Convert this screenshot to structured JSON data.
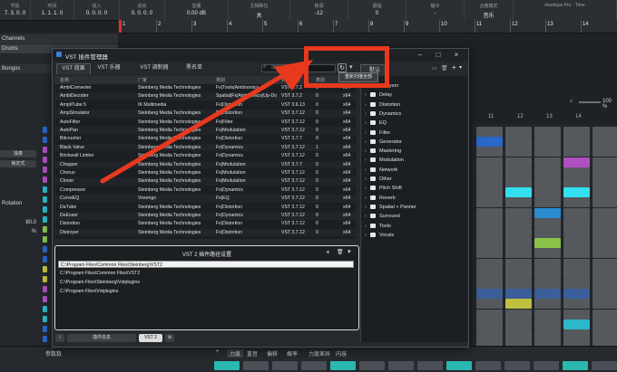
{
  "transport": [
    {
      "label": "节拍",
      "value": "7. 3. 0. 0"
    },
    {
      "label": "时间",
      "value": "1. 1. 1. 0"
    },
    {
      "label": "说入",
      "value": "0. 0. 0. 0"
    },
    {
      "label": "说出",
      "value": "0. 0. 0. 0"
    },
    {
      "label": "音量",
      "value": "0.00  dB"
    },
    {
      "label": "互相移位",
      "value": "关"
    },
    {
      "label": "移调",
      "value": "-12"
    },
    {
      "label": "振幅",
      "value": "0"
    },
    {
      "label": "轴令",
      "value": "-"
    },
    {
      "label": "合奏模式",
      "value": "音乐"
    },
    {
      "label": "elastique Pro - Time",
      "value": ""
    }
  ],
  "ruler": [
    "1",
    "2",
    "3",
    "4",
    "5",
    "6",
    "7",
    "8",
    "9",
    "10",
    "11",
    "12",
    "13",
    "14"
  ],
  "tracks": {
    "headers": [
      "Channels",
      "Drums",
      "Bongos"
    ],
    "buttons": [
      "独奏",
      "锁定式",
      "Rotation"
    ],
    "value": "80.0 %"
  },
  "pattern": {
    "zoom": "100 %",
    "columns": [
      "11",
      "12",
      "13",
      "14"
    ]
  },
  "dialog": {
    "title": "VST 插件管理器",
    "tabs": [
      "VST 效果",
      "VST 乐器",
      "VST 调制器",
      "黑名单"
    ],
    "search_placeholder": "搜索",
    "preset_tab": "默认",
    "tooltip": "重新扫描全部",
    "columns": [
      "名称",
      "厂家",
      "类别",
      "VST 版本",
      "类别",
      "位"
    ],
    "rows": [
      [
        "AmbiConverter",
        "Steinberg Media Technologies",
        "Fx|Tools|Ambisonics",
        "VST 3.7.2",
        "0",
        "x64"
      ],
      [
        "AmbiDecoder",
        "Steinberg Media Technologies",
        "Spatial|Fx|Ambisonics|Up-Do",
        "VST 3.7.2",
        "0",
        "x64"
      ],
      [
        "AmpliTube 5",
        "IK Multimedia",
        "Fx|Distortion",
        "VST 3.6.13",
        "0",
        "x64"
      ],
      [
        "AmpSimulator",
        "Steinberg Media Technologies",
        "Fx|Distortion",
        "VST 3.7.12",
        "0",
        "x64"
      ],
      [
        "AutoFilter",
        "Steinberg Media Technologies",
        "Fx|Filter",
        "VST 3.7.12",
        "0",
        "x64"
      ],
      [
        "AutoPan",
        "Steinberg Media Technologies",
        "Fx|Modulation",
        "VST 3.7.12",
        "0",
        "x64"
      ],
      [
        "Bitcrusher",
        "Steinberg Media Technologies",
        "Fx|Distortion",
        "VST 3.7.7",
        "0",
        "x64"
      ],
      [
        "Black Valve",
        "Steinberg Media Technologies",
        "Fx|Dynamics",
        "VST 3.7.12",
        "1",
        "x64"
      ],
      [
        "Brickwall Limiter",
        "Steinberg Media Technologies",
        "Fx|Dynamics",
        "VST 3.7.12",
        "0",
        "x64"
      ],
      [
        "Chopper",
        "Steinberg Media Technologies",
        "Fx|Modulation",
        "VST 3.7.7",
        "0",
        "x64"
      ],
      [
        "Chorus",
        "Steinberg Media Technologies",
        "Fx|Modulation",
        "VST 3.7.12",
        "0",
        "x64"
      ],
      [
        "Cloner",
        "Steinberg Media Technologies",
        "Fx|Modulation",
        "VST 3.7.12",
        "0",
        "x64"
      ],
      [
        "Compressor",
        "Steinberg Media Technologies",
        "Fx|Dynamics",
        "VST 3.7.12",
        "0",
        "x64"
      ],
      [
        "CurveEQ",
        "Voxengo",
        "Fx|EQ",
        "VST 3.7.12",
        "0",
        "x64"
      ],
      [
        "DaTube",
        "Steinberg Media Technologies",
        "Fx|Distortion",
        "VST 3.7.12",
        "0",
        "x64"
      ],
      [
        "DeEsser",
        "Steinberg Media Technologies",
        "Fx|Dynamics",
        "VST 3.7.12",
        "0",
        "x64"
      ],
      [
        "Distortion",
        "Steinberg Media Technologies",
        "Fx|Distortion",
        "VST 3.7.12",
        "0",
        "x64"
      ],
      [
        "Distroyer",
        "Steinberg Media Technologies",
        "Fx|Distortion",
        "VST 3.7.12",
        "0",
        "x64"
      ]
    ],
    "folders": [
      "Analyzer",
      "Delay",
      "Distortion",
      "Dynamics",
      "EQ",
      "Filter",
      "Generator",
      "Mastering",
      "Modulation",
      "Network",
      "Other",
      "Pitch Shift",
      "Reverb",
      "Spatial + Panner",
      "Surround",
      "Tools",
      "Vocals"
    ],
    "vst2_title": "VST 2 插件路径设置",
    "vst2_paths": [
      "C:\\Program Files\\Common Files\\Steinberg\\VST2",
      "C:\\Program Files\\Common Files\\VST2",
      "C:\\Program Files\\Steinberg\\Vstplugins",
      "C:\\Program Files\\Vstplugins"
    ],
    "footer": {
      "plugin_info": "插件信息",
      "vst2": "VST 2"
    }
  },
  "bottombar": {
    "label": "参数数",
    "tabs": [
      "力度",
      "重音",
      "偏移",
      "概率",
      "力度差异",
      "内容"
    ]
  }
}
